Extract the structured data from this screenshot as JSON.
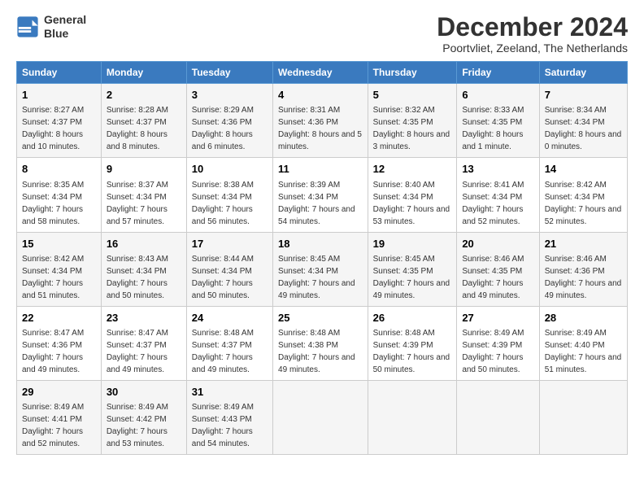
{
  "logo": {
    "line1": "General",
    "line2": "Blue"
  },
  "title": "December 2024",
  "subtitle": "Poortvliet, Zeeland, The Netherlands",
  "headers": [
    "Sunday",
    "Monday",
    "Tuesday",
    "Wednesday",
    "Thursday",
    "Friday",
    "Saturday"
  ],
  "weeks": [
    [
      {
        "day": "1",
        "sunrise": "8:27 AM",
        "sunset": "4:37 PM",
        "daylight": "8 hours and 10 minutes."
      },
      {
        "day": "2",
        "sunrise": "8:28 AM",
        "sunset": "4:37 PM",
        "daylight": "8 hours and 8 minutes."
      },
      {
        "day": "3",
        "sunrise": "8:29 AM",
        "sunset": "4:36 PM",
        "daylight": "8 hours and 6 minutes."
      },
      {
        "day": "4",
        "sunrise": "8:31 AM",
        "sunset": "4:36 PM",
        "daylight": "8 hours and 5 minutes."
      },
      {
        "day": "5",
        "sunrise": "8:32 AM",
        "sunset": "4:35 PM",
        "daylight": "8 hours and 3 minutes."
      },
      {
        "day": "6",
        "sunrise": "8:33 AM",
        "sunset": "4:35 PM",
        "daylight": "8 hours and 1 minute."
      },
      {
        "day": "7",
        "sunrise": "8:34 AM",
        "sunset": "4:34 PM",
        "daylight": "8 hours and 0 minutes."
      }
    ],
    [
      {
        "day": "8",
        "sunrise": "8:35 AM",
        "sunset": "4:34 PM",
        "daylight": "7 hours and 58 minutes."
      },
      {
        "day": "9",
        "sunrise": "8:37 AM",
        "sunset": "4:34 PM",
        "daylight": "7 hours and 57 minutes."
      },
      {
        "day": "10",
        "sunrise": "8:38 AM",
        "sunset": "4:34 PM",
        "daylight": "7 hours and 56 minutes."
      },
      {
        "day": "11",
        "sunrise": "8:39 AM",
        "sunset": "4:34 PM",
        "daylight": "7 hours and 54 minutes."
      },
      {
        "day": "12",
        "sunrise": "8:40 AM",
        "sunset": "4:34 PM",
        "daylight": "7 hours and 53 minutes."
      },
      {
        "day": "13",
        "sunrise": "8:41 AM",
        "sunset": "4:34 PM",
        "daylight": "7 hours and 52 minutes."
      },
      {
        "day": "14",
        "sunrise": "8:42 AM",
        "sunset": "4:34 PM",
        "daylight": "7 hours and 52 minutes."
      }
    ],
    [
      {
        "day": "15",
        "sunrise": "8:42 AM",
        "sunset": "4:34 PM",
        "daylight": "7 hours and 51 minutes."
      },
      {
        "day": "16",
        "sunrise": "8:43 AM",
        "sunset": "4:34 PM",
        "daylight": "7 hours and 50 minutes."
      },
      {
        "day": "17",
        "sunrise": "8:44 AM",
        "sunset": "4:34 PM",
        "daylight": "7 hours and 50 minutes."
      },
      {
        "day": "18",
        "sunrise": "8:45 AM",
        "sunset": "4:34 PM",
        "daylight": "7 hours and 49 minutes."
      },
      {
        "day": "19",
        "sunrise": "8:45 AM",
        "sunset": "4:35 PM",
        "daylight": "7 hours and 49 minutes."
      },
      {
        "day": "20",
        "sunrise": "8:46 AM",
        "sunset": "4:35 PM",
        "daylight": "7 hours and 49 minutes."
      },
      {
        "day": "21",
        "sunrise": "8:46 AM",
        "sunset": "4:36 PM",
        "daylight": "7 hours and 49 minutes."
      }
    ],
    [
      {
        "day": "22",
        "sunrise": "8:47 AM",
        "sunset": "4:36 PM",
        "daylight": "7 hours and 49 minutes."
      },
      {
        "day": "23",
        "sunrise": "8:47 AM",
        "sunset": "4:37 PM",
        "daylight": "7 hours and 49 minutes."
      },
      {
        "day": "24",
        "sunrise": "8:48 AM",
        "sunset": "4:37 PM",
        "daylight": "7 hours and 49 minutes."
      },
      {
        "day": "25",
        "sunrise": "8:48 AM",
        "sunset": "4:38 PM",
        "daylight": "7 hours and 49 minutes."
      },
      {
        "day": "26",
        "sunrise": "8:48 AM",
        "sunset": "4:39 PM",
        "daylight": "7 hours and 50 minutes."
      },
      {
        "day": "27",
        "sunrise": "8:49 AM",
        "sunset": "4:39 PM",
        "daylight": "7 hours and 50 minutes."
      },
      {
        "day": "28",
        "sunrise": "8:49 AM",
        "sunset": "4:40 PM",
        "daylight": "7 hours and 51 minutes."
      }
    ],
    [
      {
        "day": "29",
        "sunrise": "8:49 AM",
        "sunset": "4:41 PM",
        "daylight": "7 hours and 52 minutes."
      },
      {
        "day": "30",
        "sunrise": "8:49 AM",
        "sunset": "4:42 PM",
        "daylight": "7 hours and 53 minutes."
      },
      {
        "day": "31",
        "sunrise": "8:49 AM",
        "sunset": "4:43 PM",
        "daylight": "7 hours and 54 minutes."
      },
      null,
      null,
      null,
      null
    ]
  ]
}
